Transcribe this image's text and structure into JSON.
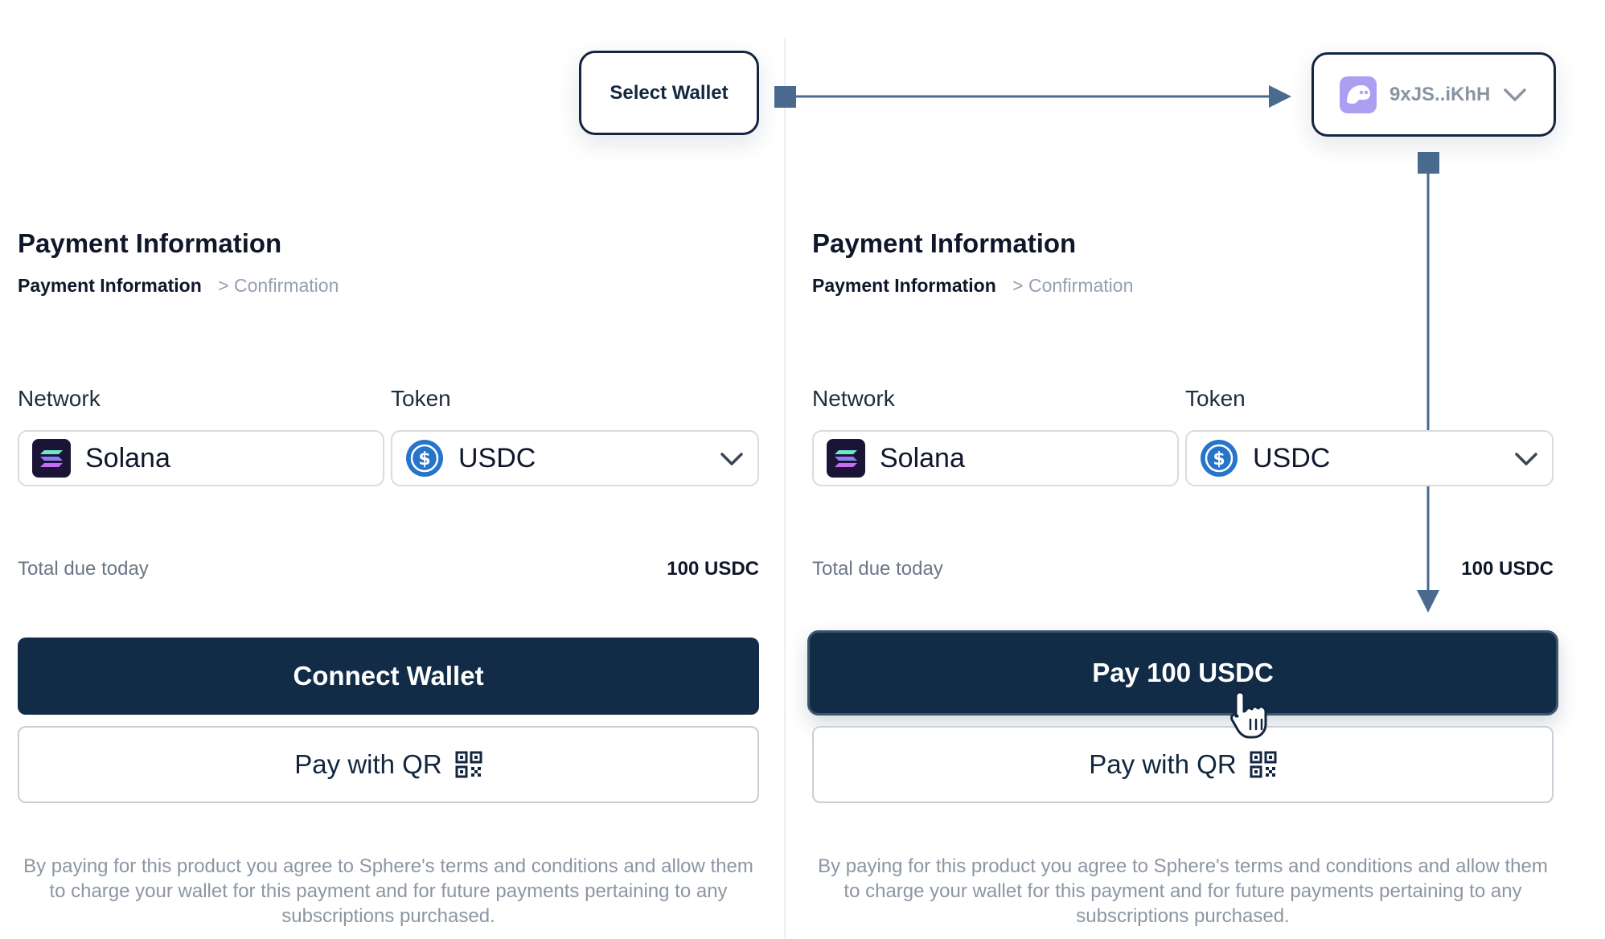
{
  "flow": {
    "select_wallet_label": "Select Wallet",
    "wallet_address": "9xJS..iKhH"
  },
  "left": {
    "title": "Payment Information",
    "breadcrumb": {
      "current": "Payment Information",
      "next": "> Confirmation"
    },
    "network": {
      "label": "Network",
      "value": "Solana"
    },
    "token": {
      "label": "Token",
      "value": "USDC"
    },
    "total": {
      "label": "Total due today",
      "value": "100 USDC"
    },
    "primary_button": "Connect Wallet",
    "qr_button": "Pay with QR",
    "legal": "By paying for this product you agree to Sphere's terms and conditions and allow them to charge your wallet for this payment and for future payments pertaining to any subscriptions purchased."
  },
  "right": {
    "title": "Payment Information",
    "breadcrumb": {
      "current": "Payment Information",
      "next": "> Confirmation"
    },
    "network": {
      "label": "Network",
      "value": "Solana"
    },
    "token": {
      "label": "Token",
      "value": "USDC"
    },
    "total": {
      "label": "Total due today",
      "value": "100 USDC"
    },
    "primary_button": "Pay 100 USDC",
    "qr_button": "Pay with QR",
    "legal": "By paying for this product you agree to Sphere's terms and conditions and allow them to charge your wallet for this payment and for future payments pertaining to any subscriptions purchased."
  },
  "colors": {
    "primary": "#122c47",
    "usdc_blue": "#2775ca",
    "phantom_purple": "#ab9ff2",
    "arrow": "#4a6a8f"
  },
  "icons": {
    "network": "solana-logo-icon",
    "token": "usdc-logo-icon",
    "wallet": "phantom-ghost-icon",
    "qr": "qr-code-icon",
    "cursor": "hand-pointer-icon"
  }
}
